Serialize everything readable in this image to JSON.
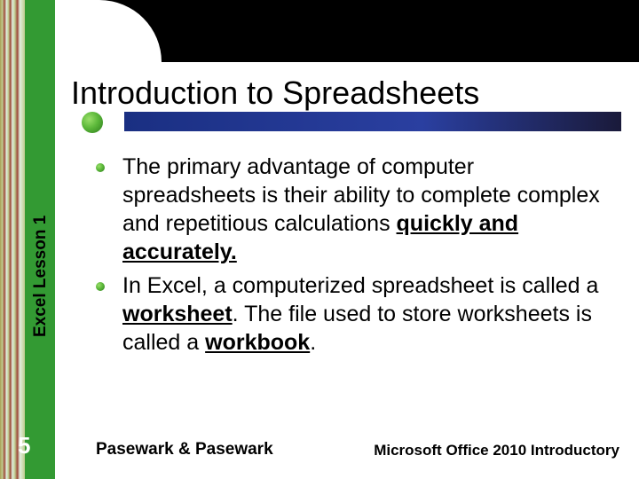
{
  "side_label": "Excel Lesson 1",
  "heading": "Introduction to Spreadsheets",
  "bullets": [
    {
      "pre": "The primary advantage of computer spreadsheets is their ability to complete complex and repetitious calculations ",
      "em1": "quickly and accurately.",
      "mid": "",
      "em2": "",
      "post": ""
    },
    {
      "pre": "In Excel, a computerized spreadsheet is called a ",
      "em1": "worksheet",
      "mid": ". The file used to store worksheets is called a ",
      "em2": "workbook",
      "post": "."
    }
  ],
  "page_number": "5",
  "footer_left": "Pasewark & Pasewark",
  "footer_right": "Microsoft Office 2010 Introductory"
}
